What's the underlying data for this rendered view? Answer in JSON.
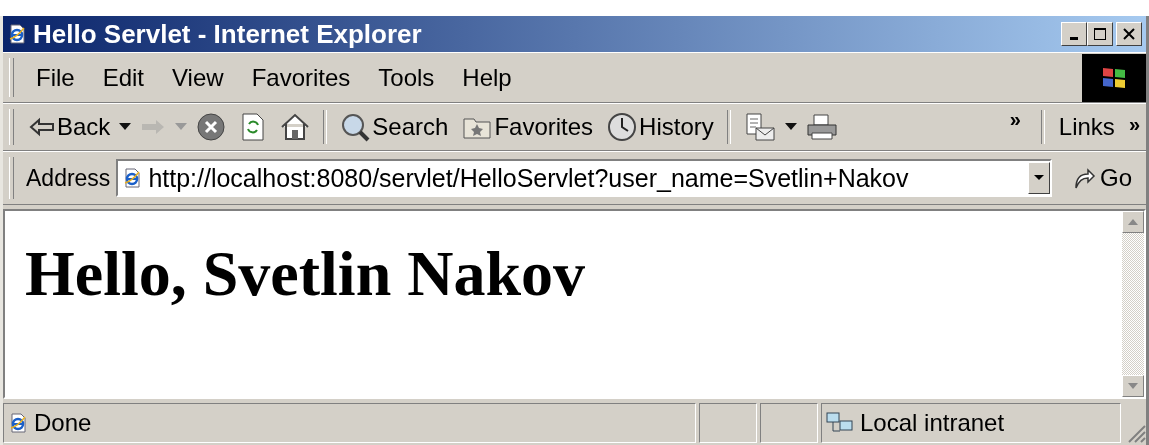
{
  "window": {
    "title": "Hello Servlet - Internet Explorer"
  },
  "menu": [
    "File",
    "Edit",
    "View",
    "Favorites",
    "Tools",
    "Help"
  ],
  "toolbar": [
    {
      "kind": "back",
      "label": "Back",
      "disabled": false,
      "dropdown": true
    },
    {
      "kind": "forward",
      "disabled": true,
      "dropdown": true
    },
    {
      "kind": "stop",
      "disabled": false
    },
    {
      "kind": "refresh",
      "disabled": false
    },
    {
      "kind": "home",
      "disabled": false
    },
    {
      "kind": "separator"
    },
    {
      "kind": "search",
      "label": "Search",
      "disabled": false
    },
    {
      "kind": "favorites",
      "label": "Favorites",
      "disabled": false
    },
    {
      "kind": "history",
      "label": "History",
      "disabled": false
    },
    {
      "kind": "separator"
    },
    {
      "kind": "mail",
      "disabled": false,
      "dropdown": true
    },
    {
      "kind": "print",
      "disabled": false
    }
  ],
  "toolbar_more": "»",
  "links": {
    "label": "Links",
    "more": "»"
  },
  "address": {
    "label": "Address",
    "value": "http://localhost:8080/servlet/HelloServlet?user_name=Svetlin+Nakov",
    "go": "Go"
  },
  "page": {
    "heading": "Hello, Svetlin Nakov"
  },
  "status_bar": {
    "text": "Done",
    "zone": "Local intranet"
  }
}
